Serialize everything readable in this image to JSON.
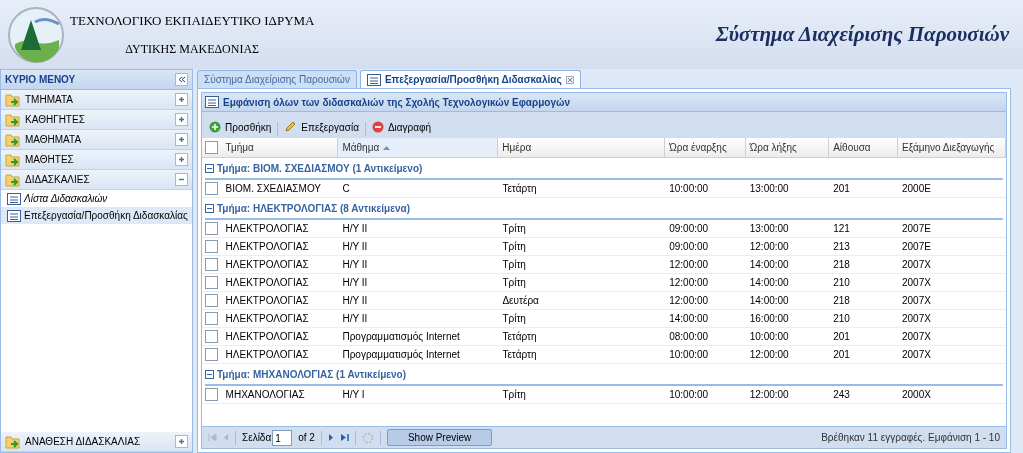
{
  "header": {
    "org_line_1": "ΤΕΧΝΟΛΟΓΙΚΟ ΕΚΠΑΙΔΕΥΤΙΚΟ ΙΔΡΥΜΑ",
    "org_line_2": "ΔΥΤΙΚΗΣ ΜΑΚΕΔΟΝΙΑΣ",
    "app_title": "Σύστημα Διαχείρισης Παρουσιών"
  },
  "sidebar": {
    "title": "ΚΥΡΙΟ ΜΕΝΟΥ",
    "sections": [
      {
        "label": "ΤΜΗΜΑΤΑ",
        "expanded": false
      },
      {
        "label": "ΚΑΘΗΓΗΤΕΣ",
        "expanded": false
      },
      {
        "label": "ΜΑΘΗΜΑΤΑ",
        "expanded": false
      },
      {
        "label": "ΜΑΘΗΤΕΣ",
        "expanded": false
      },
      {
        "label": "ΔΙΔΑΣΚΑΛΙΕΣ",
        "expanded": true,
        "children": [
          {
            "label": "Λίστα Διδασκαλιών",
            "selected": false
          },
          {
            "label": "Επεξεργασία/Προσθήκη Διδασκαλίας",
            "selected": true
          }
        ]
      },
      {
        "label": "ΑΝΑΘΕΣΗ ΔΙΔΑΣΚΑΛΙΑΣ",
        "expanded": false
      }
    ]
  },
  "tabs": [
    {
      "label": "Σύστημα Διαχείρισης Παρουσιών",
      "selected": false,
      "closable": false
    },
    {
      "label": "Επεξεργασία/Προσθήκη Διδασκαλίας",
      "selected": true,
      "closable": true
    }
  ],
  "panel": {
    "title": "Εμφάνιση όλων των διδασκαλιών της Σχολής Τεχνολογικών Εφαρμογών",
    "toolbar": [
      {
        "kind": "add",
        "label": "Προσθήκη"
      },
      {
        "kind": "edit",
        "label": "Επεξεργασία"
      },
      {
        "kind": "delete",
        "label": "Διαγραφή"
      }
    ],
    "columns": [
      {
        "label": "Τμήμα",
        "sorted": false
      },
      {
        "label": "Μάθημα",
        "sorted": true
      },
      {
        "label": "Ημέρα",
        "sorted": false
      },
      {
        "label": "Ώρα έναρξης",
        "sorted": false
      },
      {
        "label": "Ώρα λήξης",
        "sorted": false
      },
      {
        "label": "Αίθουσα",
        "sorted": false
      },
      {
        "label": "Εξάμηνο Διεξαγωγής",
        "sorted": false
      }
    ],
    "all_checked": false,
    "groups": [
      {
        "label": "Τμήμα: ΒΙΟΜ. ΣΧΕΔΙΑΣΜΟΥ (1 Αντικείμενο)",
        "expanded": true,
        "rows": [
          {
            "checked": false,
            "cells": [
              "ΒΙΟΜ. ΣΧΕΔΙΑΣΜΟΥ",
              "C",
              "Τετάρτη",
              "10:00:00",
              "13:00:00",
              "201",
              "2000Ε"
            ]
          }
        ]
      },
      {
        "label": "Τμήμα: ΗΛΕΚΤΡΟΛΟΓΙΑΣ (8 Αντικείμενα)",
        "expanded": true,
        "rows": [
          {
            "checked": false,
            "cells": [
              "ΗΛΕΚΤΡΟΛΟΓΙΑΣ",
              "Η/Υ ΙΙ",
              "Τρίτη",
              "09:00:00",
              "13:00:00",
              "121",
              "2007Ε"
            ]
          },
          {
            "checked": false,
            "cells": [
              "ΗΛΕΚΤΡΟΛΟΓΙΑΣ",
              "Η/Υ ΙΙ",
              "Τρίτη",
              "09:00:00",
              "12:00:00",
              "213",
              "2007Ε"
            ]
          },
          {
            "checked": false,
            "cells": [
              "ΗΛΕΚΤΡΟΛΟΓΙΑΣ",
              "Η/Υ ΙΙ",
              "Τρίτη",
              "12:00:00",
              "14:00:00",
              "218",
              "2007Χ"
            ]
          },
          {
            "checked": false,
            "cells": [
              "ΗΛΕΚΤΡΟΛΟΓΙΑΣ",
              "Η/Υ ΙΙ",
              "Τρίτη",
              "12:00:00",
              "14:00:00",
              "210",
              "2007Χ"
            ]
          },
          {
            "checked": false,
            "cells": [
              "ΗΛΕΚΤΡΟΛΟΓΙΑΣ",
              "Η/Υ ΙΙ",
              "Δευτέρα",
              "12:00:00",
              "14:00:00",
              "218",
              "2007Χ"
            ]
          },
          {
            "checked": false,
            "cells": [
              "ΗΛΕΚΤΡΟΛΟΓΙΑΣ",
              "Η/Υ ΙΙ",
              "Τρίτη",
              "14:00:00",
              "16:00:00",
              "210",
              "2007Χ"
            ]
          },
          {
            "checked": false,
            "cells": [
              "ΗΛΕΚΤΡΟΛΟΓΙΑΣ",
              "Προγραμματισμός Internet",
              "Τετάρτη",
              "08:00:00",
              "10:00:00",
              "201",
              "2007Χ"
            ]
          },
          {
            "checked": false,
            "cells": [
              "ΗΛΕΚΤΡΟΛΟΓΙΑΣ",
              "Προγραμματισμός Internet",
              "Τετάρτη",
              "10:00:00",
              "12:00:00",
              "201",
              "2007Χ"
            ]
          }
        ]
      },
      {
        "label": "Τμήμα: ΜΗΧΑΝΟΛΟΓΙΑΣ (1 Αντικείμενο)",
        "expanded": true,
        "rows": [
          {
            "checked": false,
            "cells": [
              "ΜΗΧΑΝΟΛΟΓΙΑΣ",
              "Η/Υ Ι",
              "Τρίτη",
              "10:00:00",
              "12:00:00",
              "243",
              "2000Χ"
            ]
          }
        ]
      }
    ],
    "paging": {
      "page_label": "Σελίδα",
      "page": "1",
      "of": "of 2",
      "preview_label": "Show Preview",
      "preview_pressed": true,
      "summary": "Βρέθηκαν 11 εγγραφές. Εμφάνιση 1 - 10"
    }
  }
}
